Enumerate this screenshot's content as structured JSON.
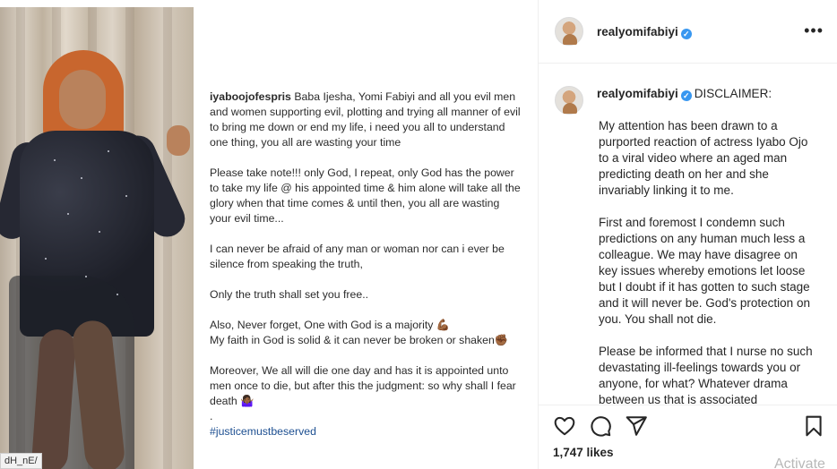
{
  "post": {
    "author": "realyomifabiyi",
    "likes": "1,747 likes"
  },
  "media": {
    "corner_badge": "dH_nE/",
    "caption": {
      "handle": "iyaboojofespris",
      "p1": "Baba Ijesha, Yomi Fabiyi and all you evil men and women supporting evil, plotting and trying all manner of evil to bring me down or end my life, i need you all to understand one thing,  you all are wasting your time",
      "p2": "Please take note!!! only God, I repeat, only God has the power to take my life @ his appointed time & him alone will take all the glory when that time comes & until then, you all are wasting your evil time...",
      "p3": " I can never be afraid of any man or woman nor can i ever be silence from speaking the truth,",
      "p4": "Only the truth shall set you free..",
      "p5a": "Also, Never forget, One with God is a majority 💪🏾",
      "p5b": "My faith in God is solid & it can never be broken or shaken✊🏾",
      "p6": "Moreover, We all will die one day and has it is appointed unto men once to die, but after this the judgment: so why shall I fear death 🤷🏾‍♀️",
      "dot": ".",
      "hashtag": "#justicemustbeserved"
    }
  },
  "comment": {
    "username": "realyomifabiyi",
    "label": "DISCLAIMER:",
    "paragraphs": [
      "My attention has been drawn to a purported reaction of actress Iyabo Ojo to a viral video where an aged man predicting death on her and she invariably linking it to me.",
      "First and foremost I condemn such predictions on any human much less a colleague. We may have disagree on key issues whereby emotions let loose but I doubt if it has gotten to such stage and it will never be. God's protection on you. You shall not die.",
      "Please be informed that I nurse no such devastating ill-feelings towards you or anyone, for what? Whatever drama between us that is associated"
    ]
  },
  "icons": {
    "like": "heart-icon",
    "comment": "comment-icon",
    "share": "share-icon",
    "save": "bookmark-icon",
    "more": "more-options-icon",
    "verified": "verified-badge-icon"
  },
  "overlay": {
    "watermark": "Activate"
  },
  "colors": {
    "verified": "#3897f0",
    "border": "#efefef",
    "text": "#262626"
  }
}
